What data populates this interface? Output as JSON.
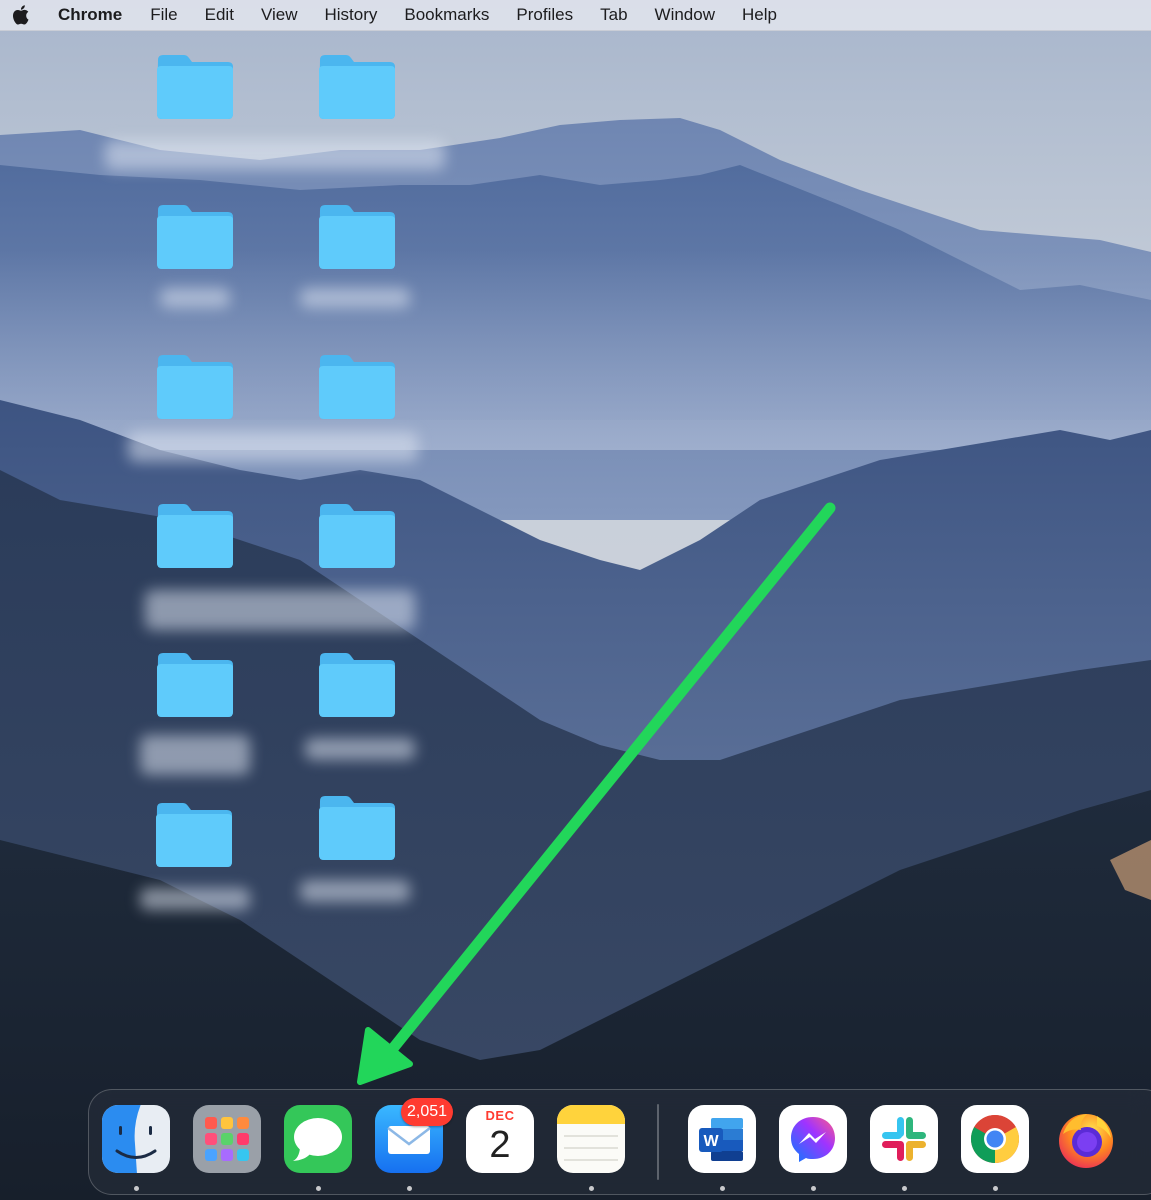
{
  "menubar": {
    "apple_icon": "apple-icon",
    "app_name": "Chrome",
    "items": [
      "File",
      "Edit",
      "View",
      "History",
      "Bookmarks",
      "Profiles",
      "Tab",
      "Window",
      "Help"
    ]
  },
  "desktop": {
    "folder_icon": "folder-icon",
    "folder_color": "#5ec8f8",
    "folders": [
      {
        "label": ""
      },
      {
        "label": ""
      },
      {
        "label": ""
      },
      {
        "label": ""
      },
      {
        "label": ""
      },
      {
        "label": ""
      },
      {
        "label": ""
      },
      {
        "label": ""
      },
      {
        "label": ""
      },
      {
        "label": ""
      },
      {
        "label": ""
      },
      {
        "label": ""
      }
    ]
  },
  "annotation": {
    "arrow_color": "#22d65a",
    "points_to": "dock"
  },
  "dock": {
    "apps": [
      {
        "name": "finder-icon",
        "running": true
      },
      {
        "name": "launchpad-icon",
        "running": false
      },
      {
        "name": "messages-icon",
        "running": true
      },
      {
        "name": "mail-icon",
        "running": true,
        "badge": "2,051"
      },
      {
        "name": "calendar-icon",
        "running": false,
        "month": "DEC",
        "day": "2"
      },
      {
        "name": "notes-icon",
        "running": true
      },
      {
        "name": "word-icon",
        "running": true
      },
      {
        "name": "messenger-icon",
        "running": true
      },
      {
        "name": "slack-icon",
        "running": true
      },
      {
        "name": "chrome-icon",
        "running": true
      },
      {
        "name": "firefox-icon",
        "running": false
      }
    ],
    "mail_badge": "2,051",
    "calendar_month": "DEC",
    "calendar_day": "2"
  }
}
